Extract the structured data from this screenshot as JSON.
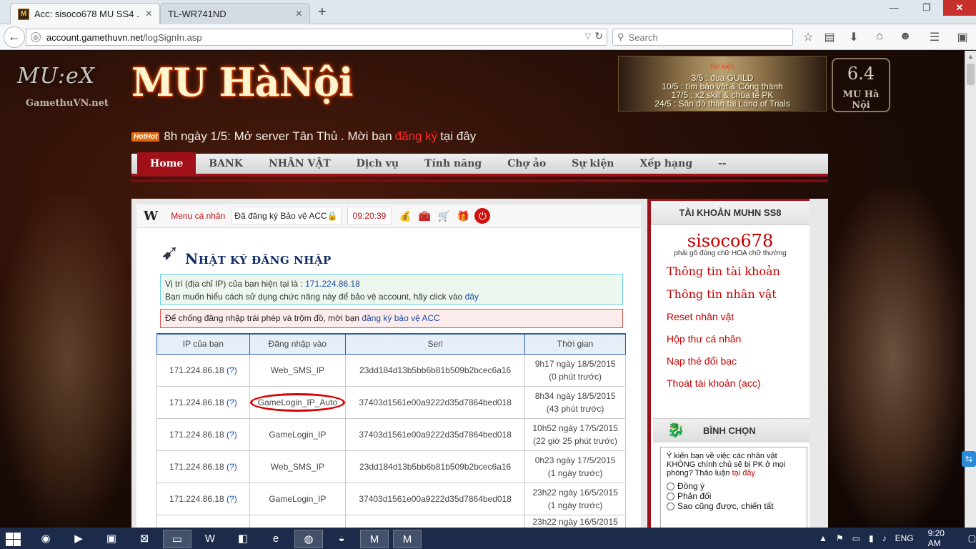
{
  "browser": {
    "tabs": [
      {
        "title": "Acc: sisoco678 MU SS4 ...",
        "active": true
      },
      {
        "title": "TL-WR741ND",
        "active": false
      }
    ],
    "new_tab_glyph": "+",
    "url_host": "account.gamethuvn.net",
    "url_path": "/logSignIn.asp",
    "search_placeholder": "Search"
  },
  "site": {
    "left_logo": "MU:eX",
    "left_logo_sub": "GamethuVN.net",
    "logo": "MU HàNội",
    "banner": {
      "title": "Sự kiện",
      "lines": [
        "3/5 : đua GUILD",
        "10/5 : tìm bảo vật & Công thành",
        "17/5 : x2 skill & chúa tể PK",
        "24/5 : Săn đồ thần tại Land of Trials"
      ]
    },
    "version": "6.4",
    "version_label": "MU Hà Nội",
    "hot_badge": "HotHot",
    "hot_text_before": "8h ngày 1/5: Mở server Tân Thủ . Mời bạn",
    "hot_link": "đăng ký",
    "hot_text_after": "tại đây",
    "menu": [
      "Home",
      "BANK",
      "NHÂN VẬT",
      "Dịch vụ",
      "Tính năng",
      "Chợ ảo",
      "Sự kiện",
      "Xếp hạng",
      "--"
    ]
  },
  "userbar": {
    "menu_label": "Menu cá nhân",
    "status": "Đã đăng ký Bảo vệ ACC",
    "clock": "09:20:39"
  },
  "page": {
    "heading_first": "N",
    "heading_rest": "HẬT KÝ ĐĂNG NHẬP",
    "ip_line_prefix": "Vị trí (địa chỉ IP) của bạn hiện tại là :",
    "ip": "171.224.86.18",
    "help_prefix": "Bạn muốn hiểu cách sử dụng chức năng này để bảo vệ account, hãy click vào",
    "help_link": "đây",
    "warn_prefix": "Để chống đăng nhập trái phép và trộm đồ, mời bạn",
    "warn_link": "đăng ký bảo vệ ACC"
  },
  "log_table": {
    "headers": [
      "IP của bạn",
      "Đăng nhập vào",
      "Seri",
      "Thời gian"
    ],
    "rows": [
      {
        "ip": "171.224.86.18",
        "q": "(?)",
        "target": "Web_SMS_IP",
        "seri": "23dd184d13b5bb6b81b509b2bcec6a16",
        "time": "9h17 ngày 18/5/2015",
        "ago": "(0 phút trước)"
      },
      {
        "ip": "171.224.86.18",
        "q": "(?)",
        "target": "GameLogin_IP_Auto",
        "seri": "37403d1561e00a9222d35d7864bed018",
        "time": "8h34 ngày 18/5/2015",
        "ago": "(43 phút trước)"
      },
      {
        "ip": "171.224.86.18",
        "q": "(?)",
        "target": "GameLogin_IP",
        "seri": "37403d1561e00a9222d35d7864bed018",
        "time": "10h52 ngày 17/5/2015",
        "ago": "(22 giờ 25 phút trước)"
      },
      {
        "ip": "171.224.86.18",
        "q": "(?)",
        "target": "Web_SMS_IP",
        "seri": "23dd184d13b5bb6b81b509b2bcec6a16",
        "time": "0h23 ngày 17/5/2015",
        "ago": "(1 ngày trước)"
      },
      {
        "ip": "171.224.86.18",
        "q": "(?)",
        "target": "GameLogin_IP",
        "seri": "37403d1561e00a9222d35d7864bed018",
        "time": "23h22 ngày 16/5/2015",
        "ago": "(1 ngày trước)"
      },
      {
        "ip": "",
        "q": "",
        "target": "",
        "seri": "",
        "time": "23h22 ngày 16/5/2015",
        "ago": ""
      }
    ]
  },
  "sidebar": {
    "title": "TÀI KHOẢN MUHN SS8",
    "username": "sisoco678",
    "hint": "phải gõ đúng chữ HOA chữ thường",
    "big_links": [
      "Thông tin tài khoản",
      "Thông tin nhân vật"
    ],
    "small_links": [
      "Reset nhân vật",
      "Hộp thư cá nhân",
      "Nạp thẻ đổi bạc",
      "Thoát tài khoản (acc)"
    ],
    "poll_title": "BÌNH CHỌN",
    "poll_question": "Ý kiến bạn về việc các nhân vật KHÔNG chính chủ sẽ bị PK ở mọi phòng? Thảo luận",
    "poll_link": "tại đây",
    "poll_options": [
      "Đồng ý",
      "Phản đối",
      "Sao cũng được, chiến tất"
    ]
  },
  "taskbar": {
    "lang": "ENG",
    "time": "9:20 AM"
  }
}
